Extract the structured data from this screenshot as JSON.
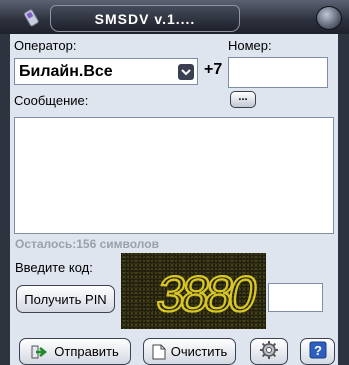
{
  "window": {
    "title": "SMSDV v.1...."
  },
  "operator": {
    "label": "Оператор:",
    "selected": "Билайн.Все"
  },
  "number": {
    "label": "Номер:",
    "prefix": "+7",
    "value": ""
  },
  "message": {
    "label": "Сообщение:",
    "more_button": "...",
    "value": ""
  },
  "remaining": {
    "text": "Осталось:156 символов"
  },
  "captcha": {
    "label": "Введите код:",
    "image_text": "3880",
    "get_pin_button": "Получить PIN",
    "code_value": ""
  },
  "actions": {
    "send_button": "Отправить",
    "clear_button": "Очистить"
  },
  "icons": {
    "app": "phone-icon",
    "close": "close-circle-icon",
    "dropdown": "chevron-down-icon",
    "send": "send-arrow-icon",
    "clear": "document-icon",
    "settings": "gear-icon",
    "help": "help-icon"
  },
  "colors": {
    "title_bar": "#2e3340",
    "panel": "#dfe5ef",
    "captcha_digits": "#d7c625",
    "muted_text": "#9aa1ad"
  }
}
